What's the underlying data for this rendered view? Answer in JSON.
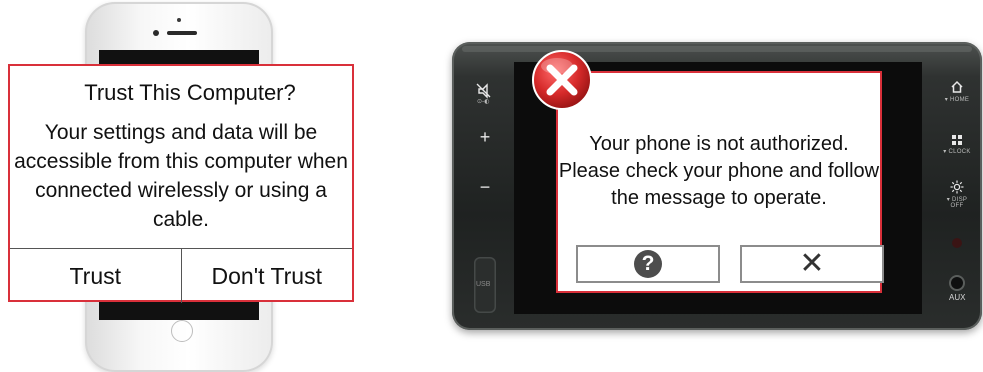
{
  "trust_dialog": {
    "title": "Trust This Computer?",
    "message": "Your settings and data will be accessible from this computer when connected wirelessly or using a cable.",
    "trust_button": "Trust",
    "dont_trust_button": "Don't Trust"
  },
  "head_unit": {
    "controls": {
      "home_caption": "▾ HOME",
      "clock_caption": "▾ CLOCK",
      "disp_caption": "▾ DISP OFF",
      "usb_label": "USB",
      "aux_label": "AUX",
      "plus": "+",
      "minus": "−",
      "mute_icon": "mute-icon"
    },
    "auth_dialog": {
      "message": "Your phone is not authorized. Please check your phone and follow the message to operate.",
      "help_button_icon": "question-mark-icon",
      "close_button_icon": "close-icon",
      "help_glyph": "?",
      "close_glyph": "✕",
      "error_icon": "error-x-icon"
    }
  },
  "colors": {
    "dialog_border": "#d9303a",
    "error_red": "#d62a2a"
  }
}
